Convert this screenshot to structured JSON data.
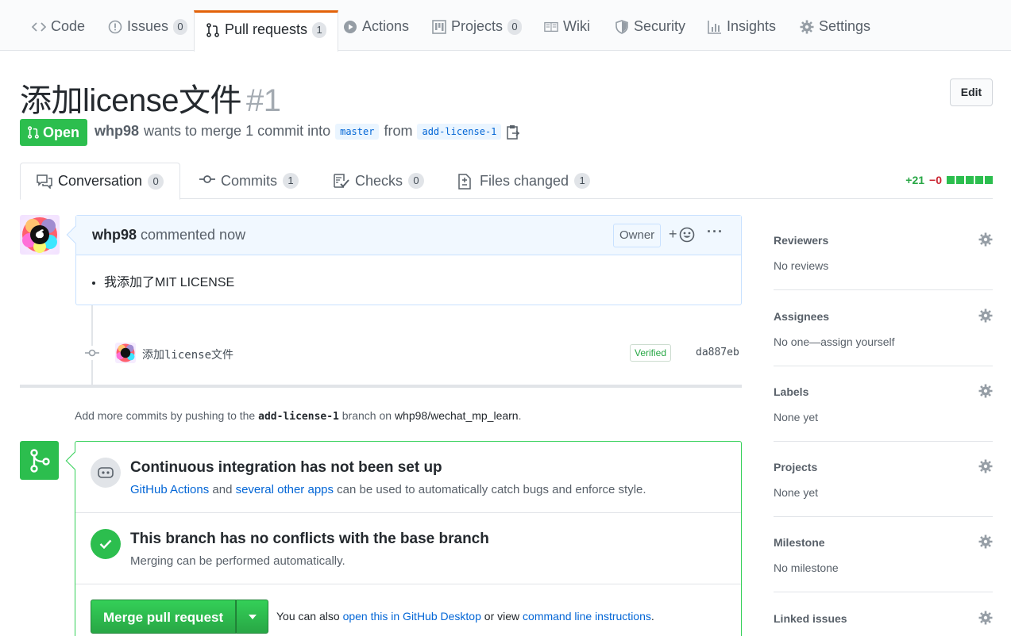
{
  "nav": {
    "tabs": [
      {
        "label": "Code",
        "icon": "code-icon",
        "count": null
      },
      {
        "label": "Issues",
        "icon": "issue-icon",
        "count": "0"
      },
      {
        "label": "Pull requests",
        "icon": "pull-request-icon",
        "count": "1"
      },
      {
        "label": "Actions",
        "icon": "play-icon",
        "count": null
      },
      {
        "label": "Projects",
        "icon": "project-icon",
        "count": "0"
      },
      {
        "label": "Wiki",
        "icon": "book-icon",
        "count": null
      },
      {
        "label": "Security",
        "icon": "shield-icon",
        "count": null
      },
      {
        "label": "Insights",
        "icon": "graph-icon",
        "count": null
      },
      {
        "label": "Settings",
        "icon": "gear-icon",
        "count": null
      }
    ]
  },
  "pr": {
    "title": "添加license文件",
    "number": "#1",
    "edit_label": "Edit",
    "state": "Open",
    "author": "whp98",
    "merge_text": "wants to merge 1 commit into",
    "base_branch": "master",
    "from_text": "from",
    "head_branch": "add-license-1"
  },
  "tabs": [
    {
      "label": "Conversation",
      "count": "0"
    },
    {
      "label": "Commits",
      "count": "1"
    },
    {
      "label": "Checks",
      "count": "0"
    },
    {
      "label": "Files changed",
      "count": "1"
    }
  ],
  "diffstat": {
    "additions": "+21",
    "deletions": "−0"
  },
  "comment": {
    "author": "whp98",
    "time": "commented now",
    "role": "Owner",
    "react": "+",
    "more": "···",
    "body_items": [
      "我添加了MIT LICENSE"
    ]
  },
  "commit": {
    "message": "添加license文件",
    "verified": "Verified",
    "sha": "da887eb"
  },
  "push_hint": {
    "prefix": "Add more commits by pushing to the",
    "branch": "add-license-1",
    "middle": "branch on",
    "repo": "whp98/wechat_mp_learn",
    "suffix": "."
  },
  "merge": {
    "ci_title": "Continuous integration has not been set up",
    "ci_link1": "GitHub Actions",
    "ci_and": "and",
    "ci_link2": "several other apps",
    "ci_rest": "can be used to automatically catch bugs and enforce style.",
    "conflict_title": "This branch has no conflicts with the base branch",
    "conflict_sub": "Merging can be performed automatically.",
    "button": "Merge pull request",
    "alt_prefix": "You can also",
    "alt_link1": "open this in GitHub Desktop",
    "alt_mid": "or view",
    "alt_link2": "command line instructions",
    "alt_suffix": "."
  },
  "sidebar": [
    {
      "title": "Reviewers",
      "value": "No reviews"
    },
    {
      "title": "Assignees",
      "value": "No one—assign yourself"
    },
    {
      "title": "Labels",
      "value": "None yet"
    },
    {
      "title": "Projects",
      "value": "None yet"
    },
    {
      "title": "Milestone",
      "value": "No milestone"
    },
    {
      "title": "Linked issues",
      "value": ""
    }
  ],
  "colors": {
    "accent": "#e36209",
    "success": "#2cbe4e",
    "link": "#0366d6"
  }
}
